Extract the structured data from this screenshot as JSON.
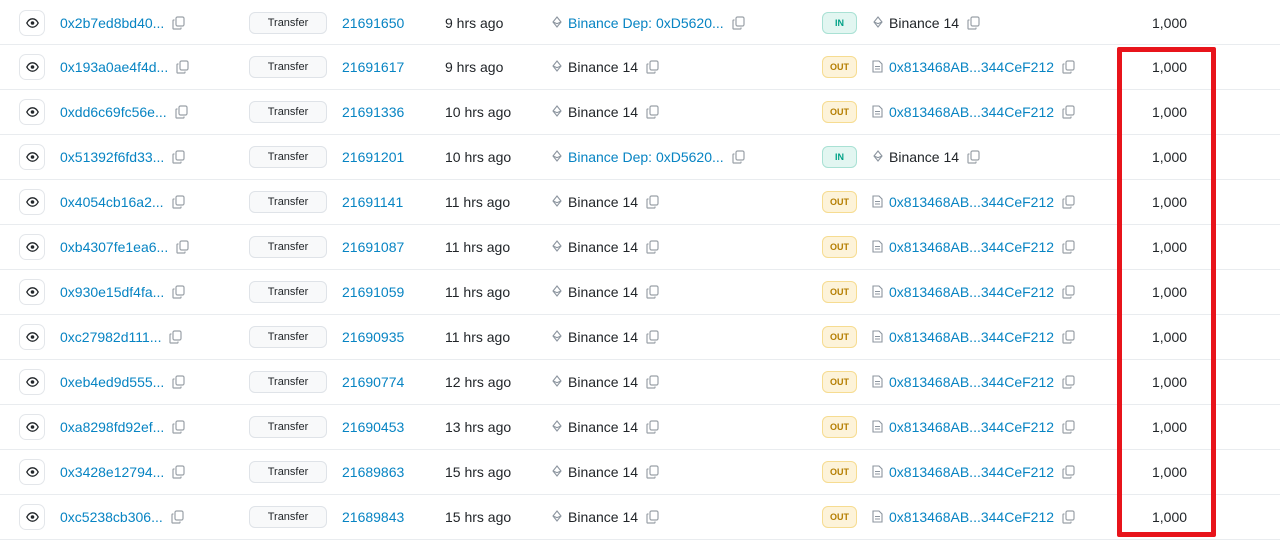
{
  "colors": {
    "link": "#0784c3",
    "in_badge": "#00a186",
    "out_badge": "#b47d00",
    "highlight": "#e8141b"
  },
  "icons": {
    "view": "eye-icon",
    "copy": "copy-icon",
    "contract": "contract-diamond-icon",
    "file": "file-icon"
  },
  "rows": [
    {
      "hash": "0x2b7ed8bd40...",
      "method": "Transfer",
      "block": "21691650",
      "age": "9 hrs ago",
      "from": "Binance Dep: 0xD5620...",
      "from_is_link": true,
      "direction": "IN",
      "to": "Binance 14",
      "to_is_link": false,
      "quantity": "1,000"
    },
    {
      "hash": "0x193a0ae4f4d...",
      "method": "Transfer",
      "block": "21691617",
      "age": "9 hrs ago",
      "from": "Binance 14",
      "from_is_link": false,
      "direction": "OUT",
      "to": "0x813468AB...344CeF212",
      "to_is_link": true,
      "quantity": "1,000"
    },
    {
      "hash": "0xdd6c69fc56e...",
      "method": "Transfer",
      "block": "21691336",
      "age": "10 hrs ago",
      "from": "Binance 14",
      "from_is_link": false,
      "direction": "OUT",
      "to": "0x813468AB...344CeF212",
      "to_is_link": true,
      "quantity": "1,000"
    },
    {
      "hash": "0x51392f6fd33...",
      "method": "Transfer",
      "block": "21691201",
      "age": "10 hrs ago",
      "from": "Binance Dep: 0xD5620...",
      "from_is_link": true,
      "direction": "IN",
      "to": "Binance 14",
      "to_is_link": false,
      "quantity": "1,000"
    },
    {
      "hash": "0x4054cb16a2...",
      "method": "Transfer",
      "block": "21691141",
      "age": "11 hrs ago",
      "from": "Binance 14",
      "from_is_link": false,
      "direction": "OUT",
      "to": "0x813468AB...344CeF212",
      "to_is_link": true,
      "quantity": "1,000"
    },
    {
      "hash": "0xb4307fe1ea6...",
      "method": "Transfer",
      "block": "21691087",
      "age": "11 hrs ago",
      "from": "Binance 14",
      "from_is_link": false,
      "direction": "OUT",
      "to": "0x813468AB...344CeF212",
      "to_is_link": true,
      "quantity": "1,000"
    },
    {
      "hash": "0x930e15df4fa...",
      "method": "Transfer",
      "block": "21691059",
      "age": "11 hrs ago",
      "from": "Binance 14",
      "from_is_link": false,
      "direction": "OUT",
      "to": "0x813468AB...344CeF212",
      "to_is_link": true,
      "quantity": "1,000"
    },
    {
      "hash": "0xc27982d111...",
      "method": "Transfer",
      "block": "21690935",
      "age": "11 hrs ago",
      "from": "Binance 14",
      "from_is_link": false,
      "direction": "OUT",
      "to": "0x813468AB...344CeF212",
      "to_is_link": true,
      "quantity": "1,000"
    },
    {
      "hash": "0xeb4ed9d555...",
      "method": "Transfer",
      "block": "21690774",
      "age": "12 hrs ago",
      "from": "Binance 14",
      "from_is_link": false,
      "direction": "OUT",
      "to": "0x813468AB...344CeF212",
      "to_is_link": true,
      "quantity": "1,000"
    },
    {
      "hash": "0xa8298fd92ef...",
      "method": "Transfer",
      "block": "21690453",
      "age": "13 hrs ago",
      "from": "Binance 14",
      "from_is_link": false,
      "direction": "OUT",
      "to": "0x813468AB...344CeF212",
      "to_is_link": true,
      "quantity": "1,000"
    },
    {
      "hash": "0x3428e12794...",
      "method": "Transfer",
      "block": "21689863",
      "age": "15 hrs ago",
      "from": "Binance 14",
      "from_is_link": false,
      "direction": "OUT",
      "to": "0x813468AB...344CeF212",
      "to_is_link": true,
      "quantity": "1,000"
    },
    {
      "hash": "0xc5238cb306...",
      "method": "Transfer",
      "block": "21689843",
      "age": "15 hrs ago",
      "from": "Binance 14",
      "from_is_link": false,
      "direction": "OUT",
      "to": "0x813468AB...344CeF212",
      "to_is_link": true,
      "quantity": "1,000"
    }
  ]
}
